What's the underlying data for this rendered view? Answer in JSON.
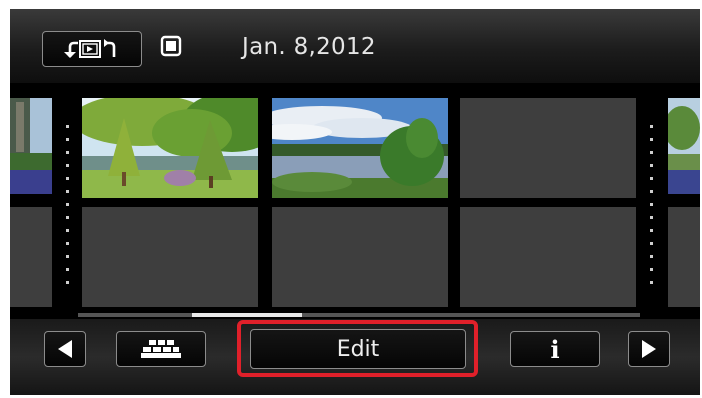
{
  "header": {
    "date": "Jan.  8,2012",
    "return_button_icon": "return-playback-icon",
    "memory_icon": "memory-card-icon"
  },
  "thumbnails": [
    {
      "row": 1,
      "col": 1,
      "kind": "photo-trees-lake"
    },
    {
      "row": 1,
      "col": 2,
      "kind": "photo-lake-sky"
    },
    {
      "row": 1,
      "col": 3,
      "kind": "empty"
    },
    {
      "row": 2,
      "col": 1,
      "kind": "empty"
    },
    {
      "row": 2,
      "col": 2,
      "kind": "empty"
    },
    {
      "row": 2,
      "col": 3,
      "kind": "empty"
    }
  ],
  "footer": {
    "prev_icon": "left-arrow-icon",
    "index_icon": "index-screen-icon",
    "edit_label": "Edit",
    "info_label": "i",
    "next_icon": "right-arrow-icon"
  },
  "colors": {
    "highlight": "#e0202a",
    "button_border": "#8c8c8c",
    "empty_thumb": "#3e3e3e"
  }
}
